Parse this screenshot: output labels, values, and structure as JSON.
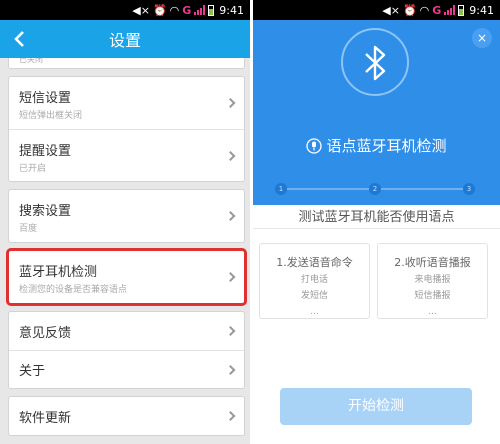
{
  "status_bar": {
    "time": "9:41",
    "network_letter": "G"
  },
  "settings": {
    "title": "设置",
    "cut_subtitle": "已关闭",
    "groups": [
      [
        {
          "title": "短信设置",
          "subtitle": "短信弹出框关闭"
        },
        {
          "title": "提醒设置",
          "subtitle": "已开启"
        }
      ],
      [
        {
          "title": "搜索设置",
          "subtitle": "百度"
        }
      ],
      [
        {
          "title": "蓝牙耳机检测",
          "subtitle": "检测您的设备是否兼容语点",
          "highlighted": true
        }
      ],
      [
        {
          "title": "意见反馈"
        },
        {
          "title": "关于"
        }
      ],
      [
        {
          "title": "软件更新"
        }
      ]
    ]
  },
  "bt_test": {
    "close_label": "×",
    "heading": "语点蓝牙耳机检测",
    "steps": [
      "1",
      "2",
      "3"
    ],
    "prompt": "测试蓝牙耳机能否使用语点",
    "cards": [
      {
        "title": "1.发送语音命令",
        "lines": [
          "打电话",
          "发短信",
          "..."
        ]
      },
      {
        "title": "2.收听语音播报",
        "lines": [
          "来电播报",
          "短信播报",
          "..."
        ]
      }
    ],
    "start_button": "开始检测"
  },
  "colors": {
    "header_blue": "#1aa3e6",
    "panel_blue": "#2f8ee8",
    "highlight_red": "#e03131"
  }
}
